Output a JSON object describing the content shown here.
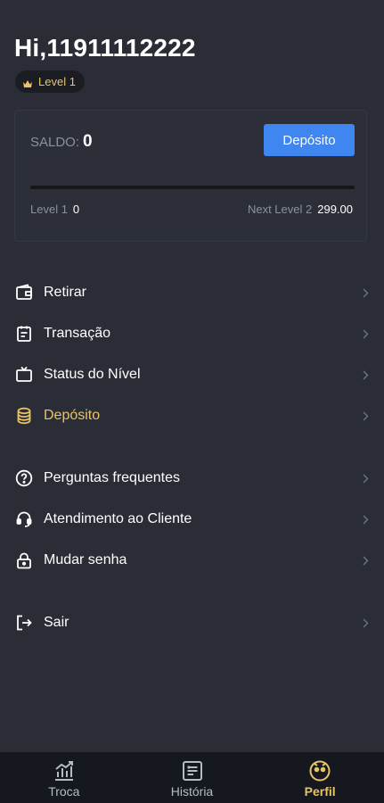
{
  "header": {
    "greeting": "Hi,11911112222",
    "level_badge": "Level 1"
  },
  "balance": {
    "label": "SALDO:",
    "value": "0",
    "deposit_button": "Depósito",
    "progress_fraction": 0,
    "current_level_label": "Level 1",
    "current_level_value": "0",
    "next_level_label": "Next Level 2",
    "next_level_value": "299.00"
  },
  "menu": {
    "group1": [
      {
        "label": "Retirar",
        "icon": "wallet-icon"
      },
      {
        "label": "Transação",
        "icon": "clipboard-icon"
      },
      {
        "label": "Status do Nível",
        "icon": "tv-icon"
      },
      {
        "label": "Depósito",
        "icon": "coins-icon"
      }
    ],
    "group2": [
      {
        "label": "Perguntas frequentes",
        "icon": "question-icon"
      },
      {
        "label": "Atendimento ao Cliente",
        "icon": "headset-icon"
      },
      {
        "label": "Mudar senha",
        "icon": "lock-icon"
      }
    ],
    "group3": [
      {
        "label": "Sair",
        "icon": "logout-icon"
      }
    ]
  },
  "tabs": [
    {
      "label": "Troca",
      "icon": "chart-icon"
    },
    {
      "label": "História",
      "icon": "history-icon"
    },
    {
      "label": "Perfil",
      "icon": "profile-face-icon"
    }
  ],
  "colors": {
    "background": "#2a2d36",
    "accent_blue": "#3f86f0",
    "accent_gold": "#e8c467",
    "tabbar": "#15181e"
  }
}
